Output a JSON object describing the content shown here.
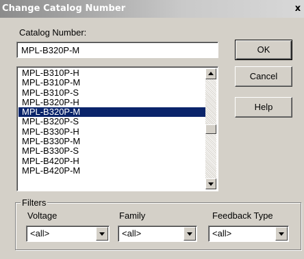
{
  "window": {
    "title": "Change Catalog Number",
    "close_glyph": "x"
  },
  "catalog": {
    "label": "Catalog Number:",
    "value": "MPL-B320P-M"
  },
  "buttons": {
    "ok": "OK",
    "cancel": "Cancel",
    "help": "Help"
  },
  "list": {
    "items": [
      "MPL-B310P-H",
      "MPL-B310P-M",
      "MPL-B310P-S",
      "MPL-B320P-H",
      "MPL-B320P-M",
      "MPL-B320P-S",
      "MPL-B330P-H",
      "MPL-B330P-M",
      "MPL-B330P-S",
      "MPL-B420P-H",
      "MPL-B420P-M"
    ],
    "selected_index": 4
  },
  "filters": {
    "label": "Filters",
    "voltage": {
      "label": "Voltage",
      "value": "<all>"
    },
    "family": {
      "label": "Family",
      "value": "<all>"
    },
    "feedback": {
      "label": "Feedback Type",
      "value": "<all>"
    }
  },
  "colors": {
    "selection": "#0a246a",
    "face": "#d4d0c8"
  }
}
